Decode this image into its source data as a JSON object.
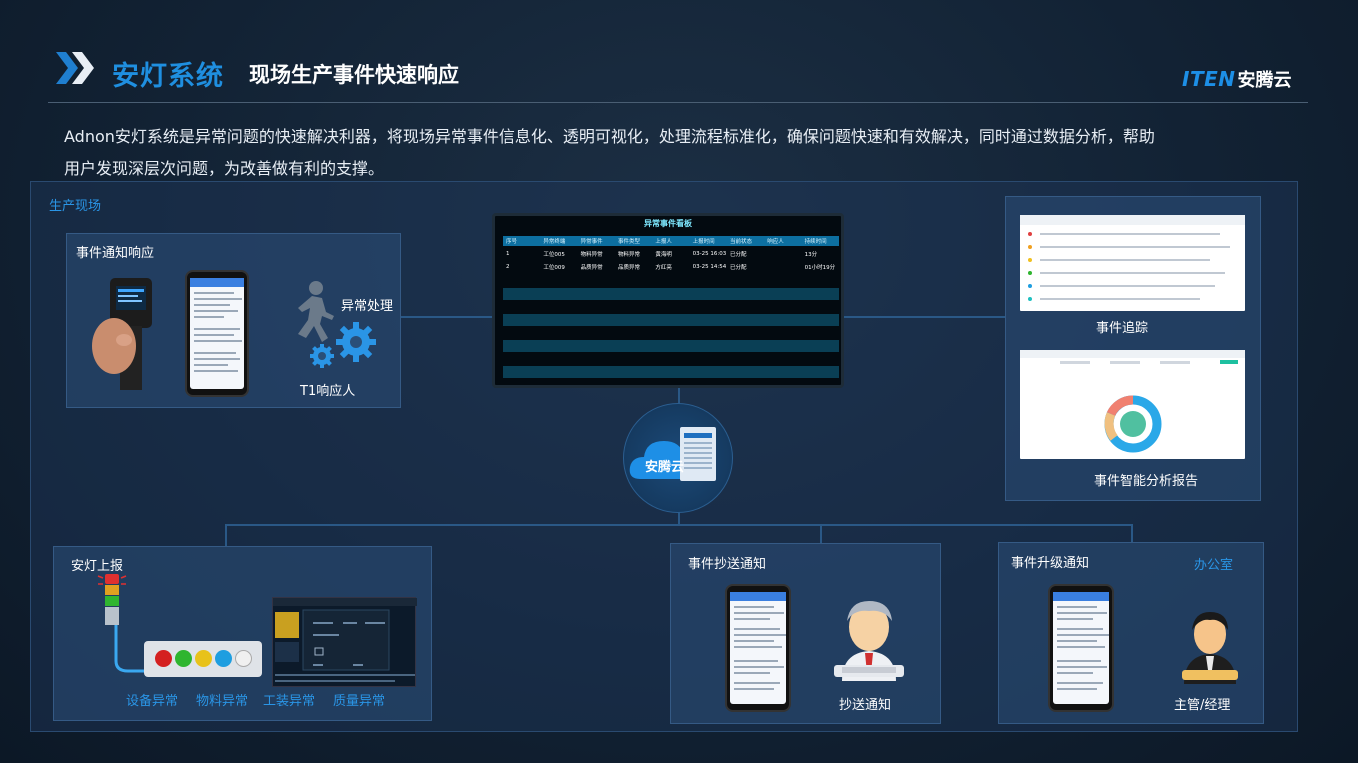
{
  "header": {
    "title_main": "安灯系统",
    "title_sub": "现场生产事件快速响应",
    "brand_logo": "ITEN",
    "brand_name": "安腾云"
  },
  "intro": {
    "line1": "Adnon安灯系统是异常问题的快速解决利器，将现场异常事件信息化、透明可视化，处理流程标准化，确保问题快速和有效解决，同时通过数据分析，帮助",
    "line2": "用户发现深层次问题，为改善做有利的支撑。"
  },
  "zone_label": "生产现场",
  "notify_panel": {
    "title": "事件通知响应",
    "handle_label": "异常处理",
    "responder_label": "T1响应人"
  },
  "dashboard": {
    "title": "异常事件看板",
    "columns": [
      "序号",
      "异常终端",
      "异常事件",
      "事件类型",
      "上报人",
      "上报时间",
      "当前状态",
      "响应人",
      "持续时间"
    ],
    "rows": [
      [
        "1",
        "工位005",
        "物料异常",
        "物料异常",
        "黄海明",
        "03-25 16:03",
        "已分配",
        "",
        "13分"
      ],
      [
        "2",
        "工位009",
        "品质异常",
        "品质异常",
        "方红亮",
        "03-25 14:54",
        "已分配",
        "",
        "01小时19分"
      ]
    ]
  },
  "cloud_label": "安腾云",
  "tracking": {
    "label": "事件追踪"
  },
  "analysis": {
    "label": "事件智能分析报告"
  },
  "andon_panel": {
    "title": "安灯上报",
    "buttons": [
      "设备异常",
      "物料异常",
      "工装异常",
      "质量异常"
    ],
    "button_colors": [
      "#d42020",
      "#2fb52f",
      "#e8c21a",
      "#1e9ee0",
      "#f0f0f0"
    ]
  },
  "cc_panel": {
    "title": "事件抄送通知",
    "person_label": "抄送通知"
  },
  "escalate_panel": {
    "title": "事件升级通知",
    "office_label": "办公室",
    "person_label": "主管/经理"
  }
}
